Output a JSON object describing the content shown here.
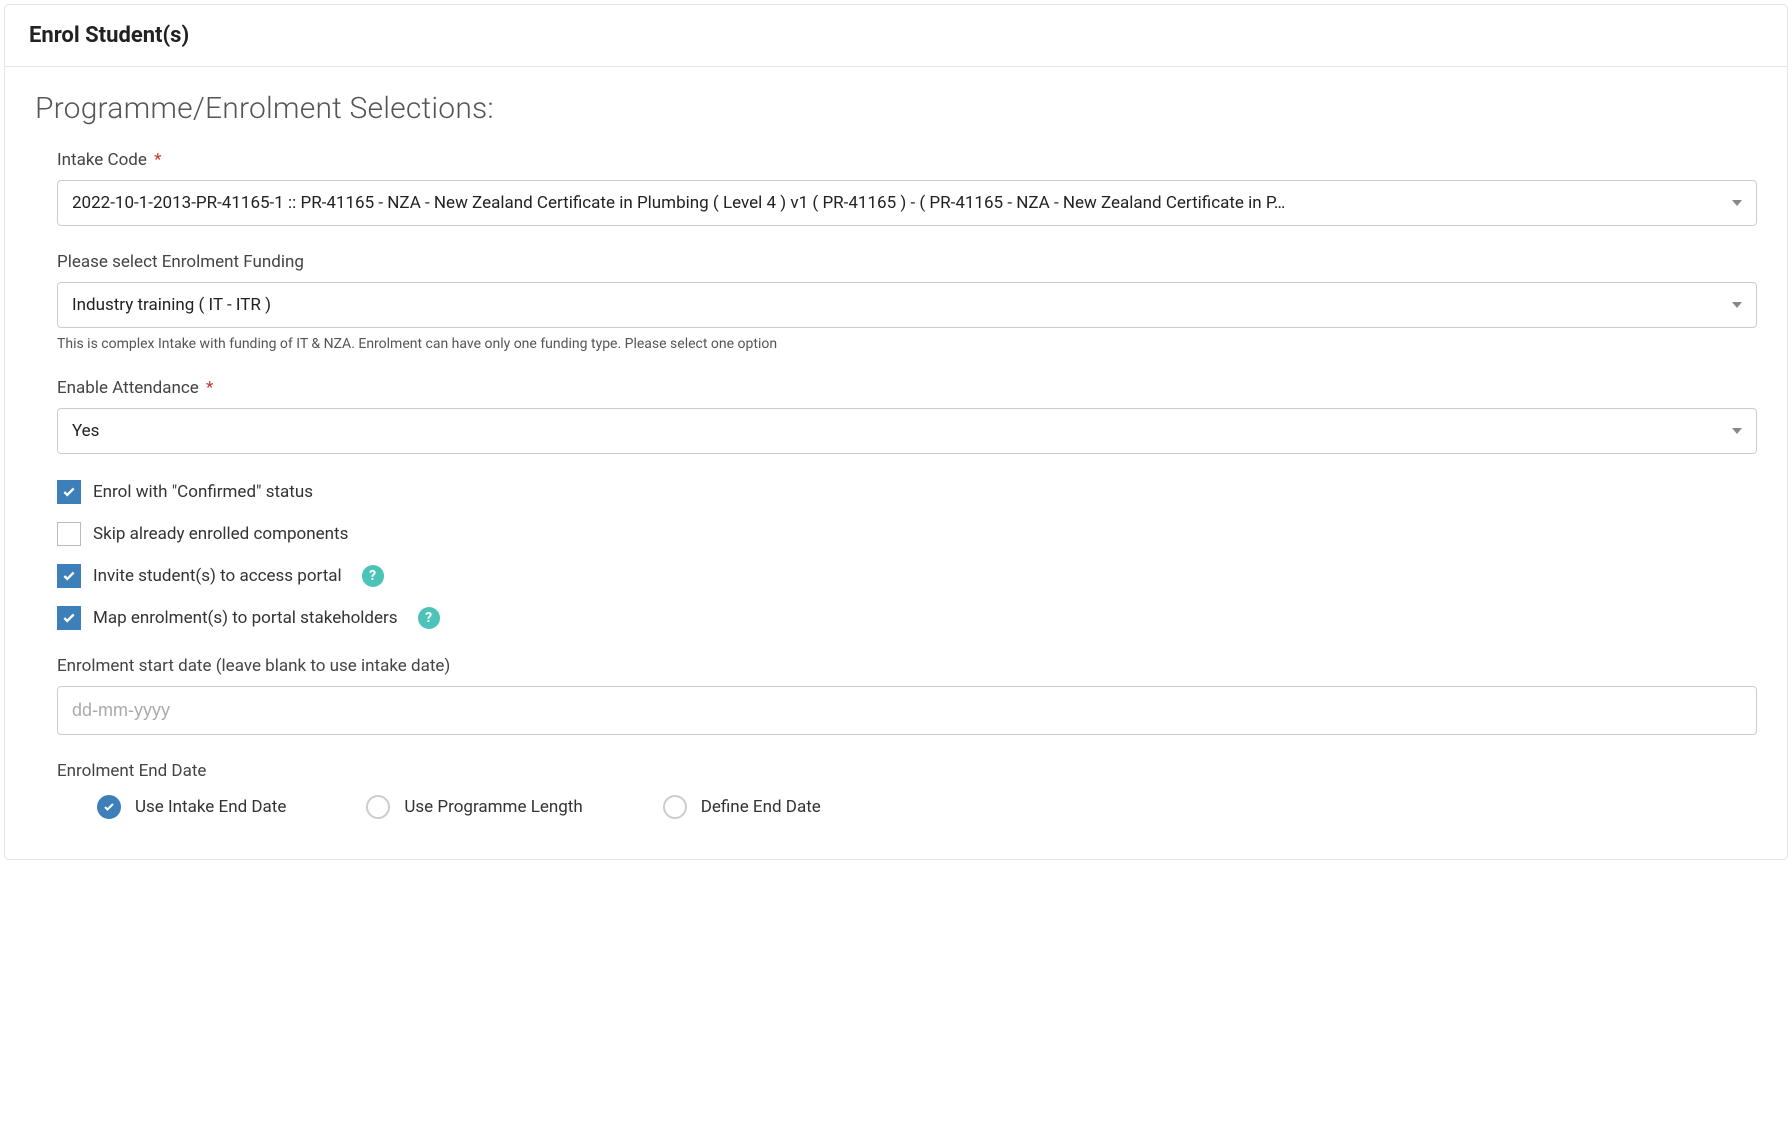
{
  "header": {
    "title": "Enrol Student(s)"
  },
  "section": {
    "title": "Programme/Enrolment Selections:"
  },
  "intake": {
    "label": "Intake Code",
    "required": "*",
    "value": "2022-10-1-2013-PR-41165-1 :: PR-41165 - NZA - New Zealand Certificate in Plumbing ( Level 4 ) v1 ( PR-41165 ) - ( PR-41165 - NZA - New Zealand Certificate in P…"
  },
  "funding": {
    "label": "Please select Enrolment Funding",
    "value": "Industry training ( IT - ITR )",
    "help": "This is complex Intake with funding of IT & NZA. Enrolment can have only one funding type. Please select one option"
  },
  "attendance": {
    "label": "Enable Attendance",
    "required": "*",
    "value": "Yes"
  },
  "checkboxes": {
    "confirmed": {
      "label": "Enrol with \"Confirmed\" status",
      "checked": true
    },
    "skip": {
      "label": "Skip already enrolled components",
      "checked": false
    },
    "invite": {
      "label": "Invite student(s) to access portal",
      "checked": true,
      "help": "?"
    },
    "map": {
      "label": "Map enrolment(s) to portal stakeholders",
      "checked": true,
      "help": "?"
    }
  },
  "startDate": {
    "label": "Enrolment start date (leave blank to use intake date)",
    "placeholder": "dd-mm-yyyy",
    "value": ""
  },
  "endDate": {
    "label": "Enrolment End Date",
    "options": {
      "useIntake": {
        "label": "Use Intake End Date",
        "selected": true
      },
      "useProgramme": {
        "label": "Use Programme Length",
        "selected": false
      },
      "define": {
        "label": "Define End Date",
        "selected": false
      }
    }
  }
}
